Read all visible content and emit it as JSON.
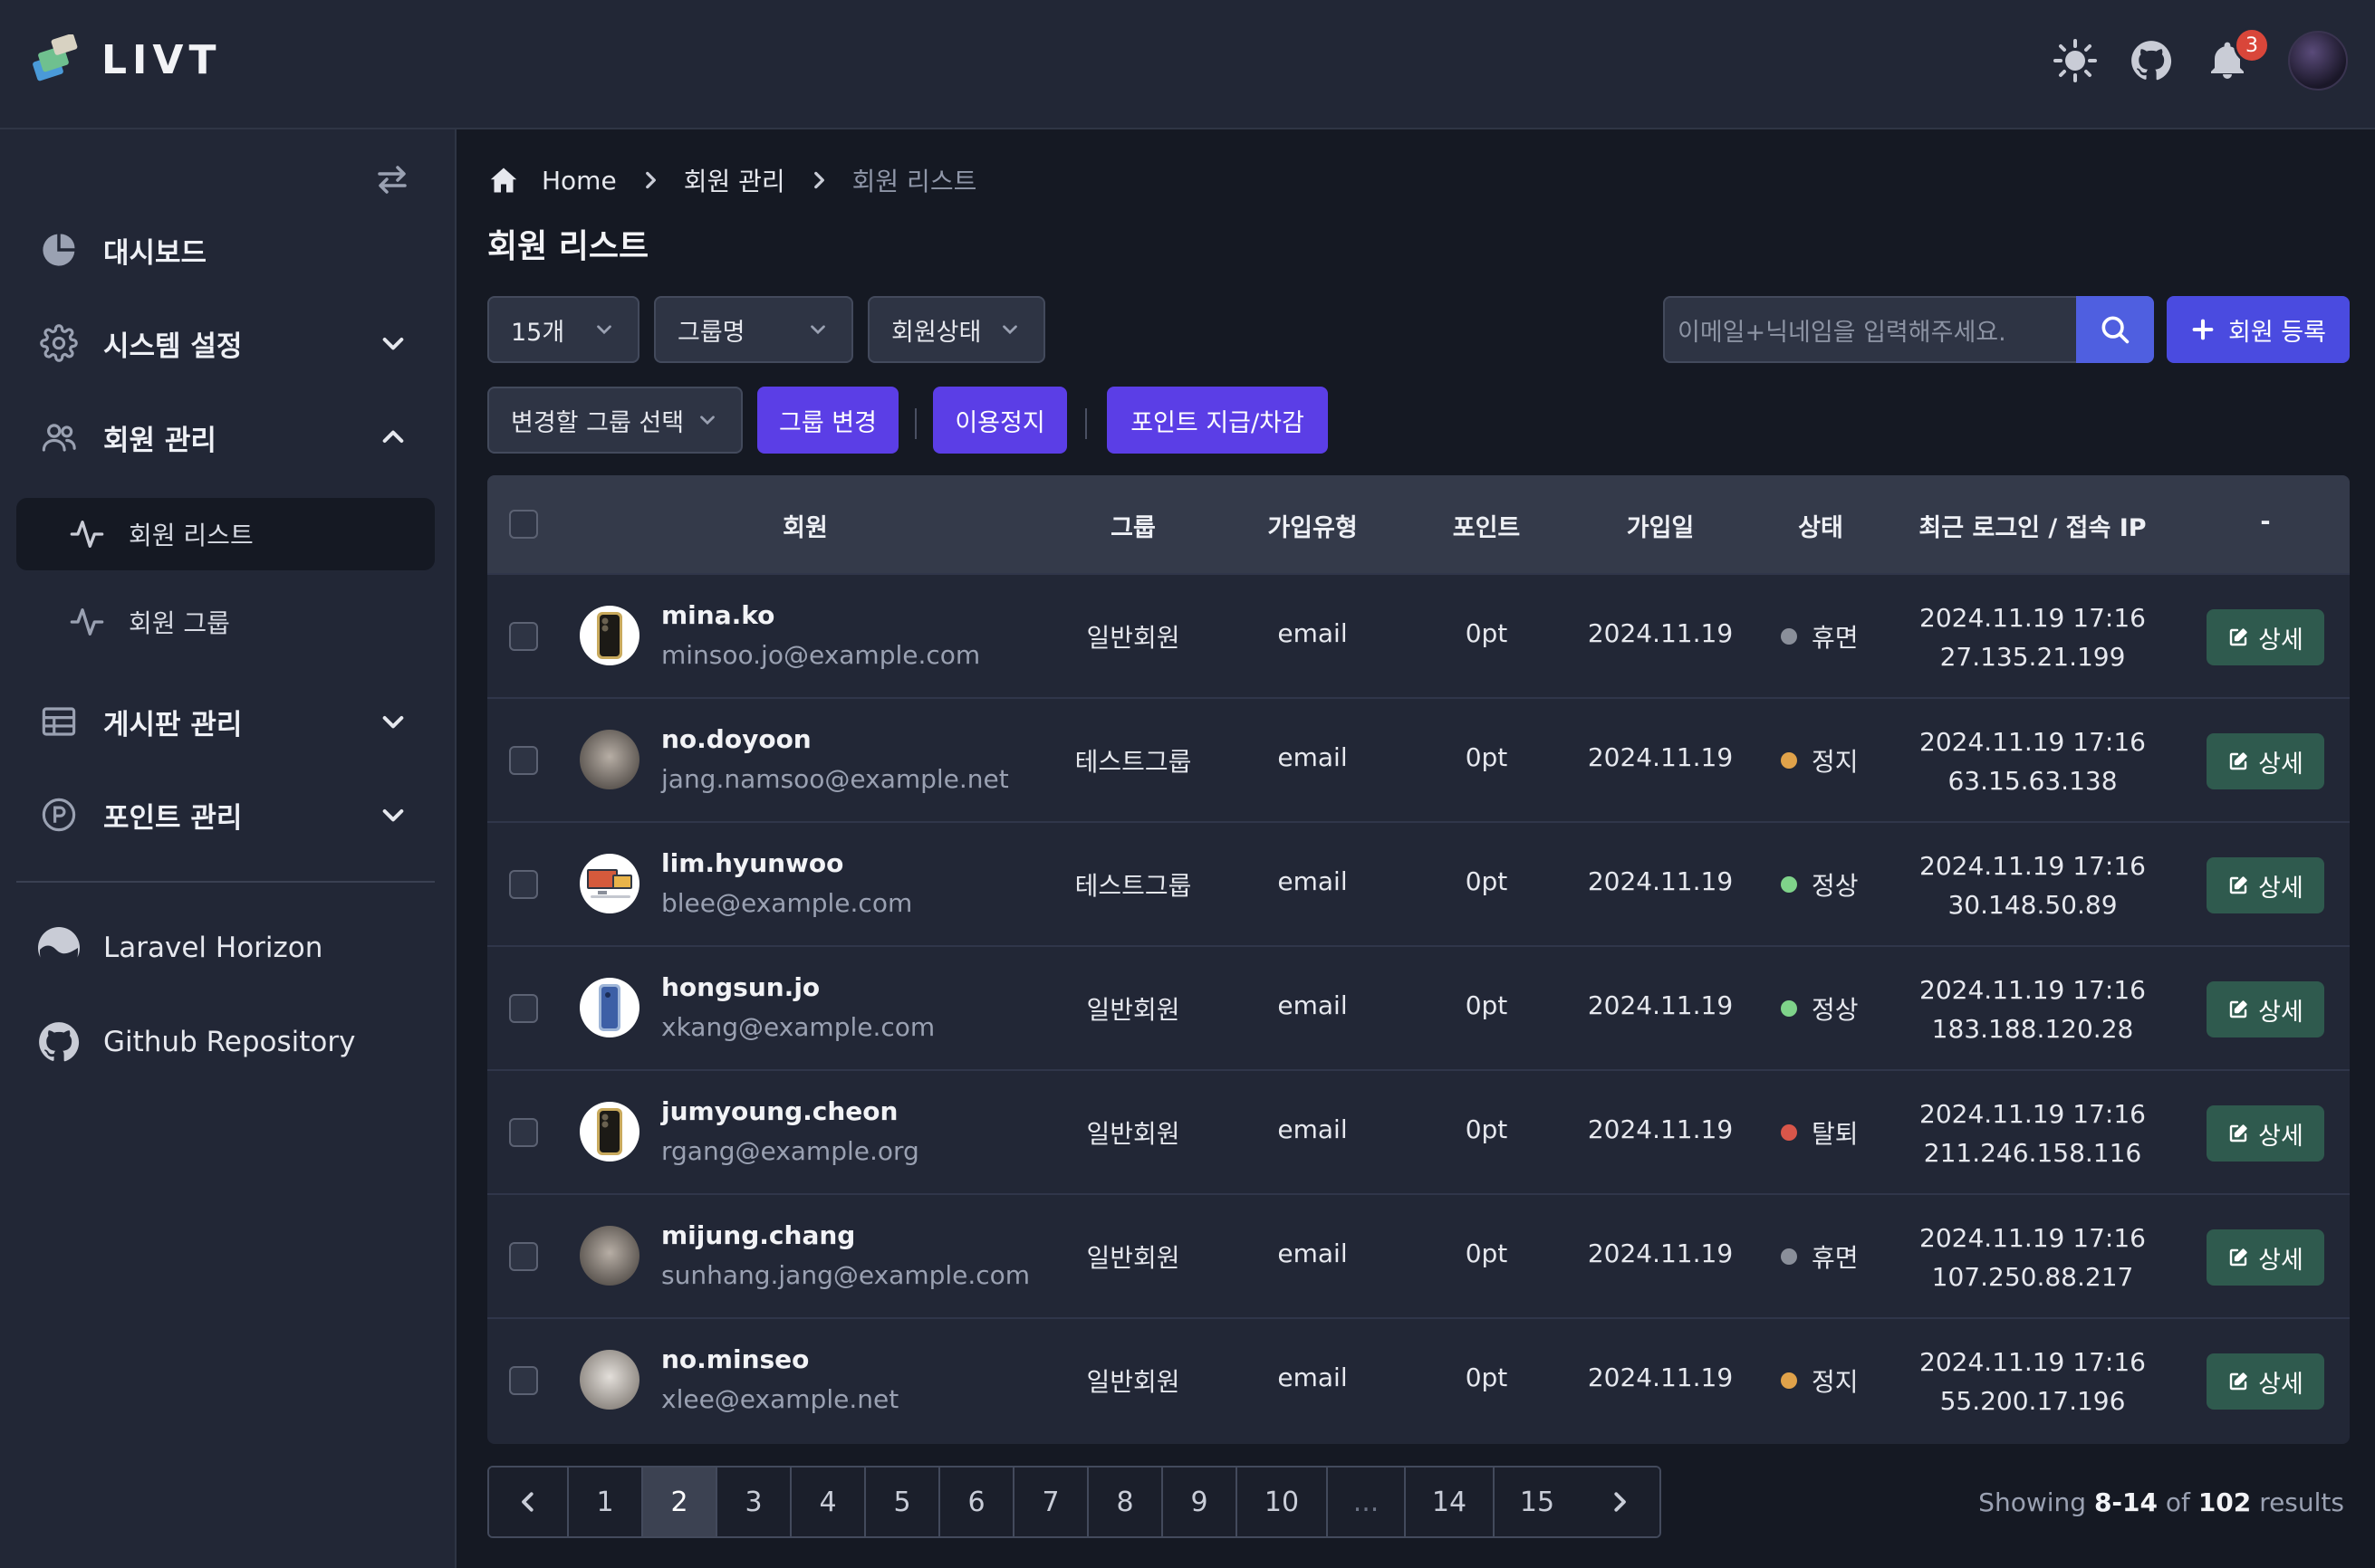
{
  "app": {
    "logo_text": "LIVT",
    "notification_count": "3"
  },
  "sidebar": {
    "items": [
      {
        "label": "대시보드",
        "icon": "pie-chart-icon"
      },
      {
        "label": "시스템 설정",
        "icon": "gear-icon"
      },
      {
        "label": "회원 관리",
        "icon": "users-icon"
      },
      {
        "label": "게시판 관리",
        "icon": "table-icon"
      },
      {
        "label": "포인트 관리",
        "icon": "point-icon"
      }
    ],
    "subitems": [
      {
        "label": "회원 리스트",
        "active": true
      },
      {
        "label": "회원 그룹",
        "active": false
      }
    ],
    "external": [
      {
        "label": "Laravel Horizon"
      },
      {
        "label": "Github Repository"
      }
    ]
  },
  "breadcrumb": [
    "Home",
    "회원 관리",
    "회원 리스트"
  ],
  "page": {
    "title": "회원 리스트"
  },
  "filters": {
    "per_page": "15개",
    "group": "그룹명",
    "status": "회원상태",
    "change_group": "변경할 그룹 선택"
  },
  "actions": {
    "group_change": "그룹 변경",
    "suspend": "이용정지",
    "points": "포인트 지급/차감",
    "add_member": "회원 등록"
  },
  "search": {
    "placeholder": "이메일+닉네임을 입력해주세요."
  },
  "table": {
    "headers": [
      "회원",
      "그룹",
      "가입유형",
      "포인트",
      "가입일",
      "상태",
      "최근 로그인 / 접속 IP",
      "-"
    ],
    "detail_label": "상세",
    "rows": [
      {
        "nick": "mina.ko",
        "email": "minsoo.jo@example.com",
        "group": "일반회원",
        "type": "email",
        "points": "0pt",
        "joined": "2024.11.19",
        "status": "휴면",
        "status_color": "#8a8f9a",
        "login": "2024.11.19 17:16",
        "ip": "27.135.21.199",
        "thumb": "phone"
      },
      {
        "nick": "no.doyoon",
        "email": "jang.namsoo@example.net",
        "group": "테스트그룹",
        "type": "email",
        "points": "0pt",
        "joined": "2024.11.19",
        "status": "정지",
        "status_color": "#e0a24a",
        "login": "2024.11.19 17:16",
        "ip": "63.15.63.138",
        "thumb": "cat"
      },
      {
        "nick": "lim.hyunwoo",
        "email": "blee@example.com",
        "group": "테스트그룹",
        "type": "email",
        "points": "0pt",
        "joined": "2024.11.19",
        "status": "정상",
        "status_color": "#7fd38a",
        "login": "2024.11.19 17:16",
        "ip": "30.148.50.89",
        "thumb": "pc"
      },
      {
        "nick": "hongsun.jo",
        "email": "xkang@example.com",
        "group": "일반회원",
        "type": "email",
        "points": "0pt",
        "joined": "2024.11.19",
        "status": "정상",
        "status_color": "#7fd38a",
        "login": "2024.11.19 17:16",
        "ip": "183.188.120.28",
        "thumb": "phone2"
      },
      {
        "nick": "jumyoung.cheon",
        "email": "rgang@example.org",
        "group": "일반회원",
        "type": "email",
        "points": "0pt",
        "joined": "2024.11.19",
        "status": "탈퇴",
        "status_color": "#d9564a",
        "login": "2024.11.19 17:16",
        "ip": "211.246.158.116",
        "thumb": "phone"
      },
      {
        "nick": "mijung.chang",
        "email": "sunhang.jang@example.com",
        "group": "일반회원",
        "type": "email",
        "points": "0pt",
        "joined": "2024.11.19",
        "status": "휴면",
        "status_color": "#8a8f9a",
        "login": "2024.11.19 17:16",
        "ip": "107.250.88.217",
        "thumb": "cat"
      },
      {
        "nick": "no.minseo",
        "email": "xlee@example.net",
        "group": "일반회원",
        "type": "email",
        "points": "0pt",
        "joined": "2024.11.19",
        "status": "정지",
        "status_color": "#e0a24a",
        "login": "2024.11.19 17:16",
        "ip": "55.200.17.196",
        "thumb": "cat2"
      }
    ]
  },
  "pagination": {
    "pages": [
      "1",
      "2",
      "3",
      "4",
      "5",
      "6",
      "7",
      "8",
      "9",
      "10",
      "...",
      "14",
      "15"
    ],
    "current": "2"
  },
  "summary": {
    "prefix": "Showing",
    "range": "8-14",
    "of": "of",
    "total": "102",
    "suffix": "results"
  },
  "colors": {
    "accent": "#5b3ee6",
    "primary": "#4a4be0",
    "detail": "#2f5a4e"
  }
}
